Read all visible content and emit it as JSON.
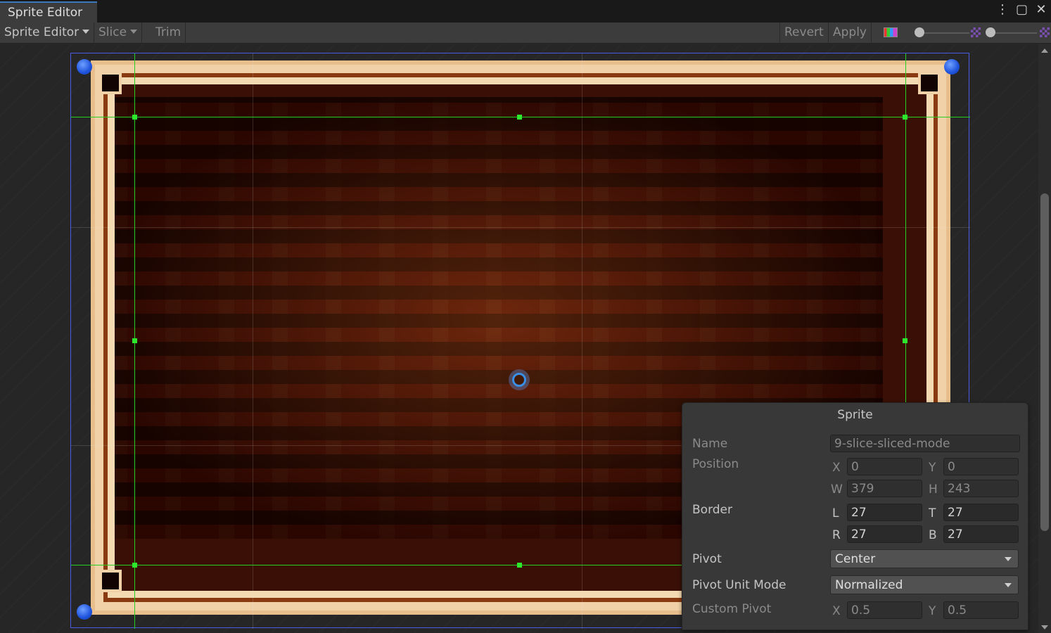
{
  "window": {
    "tab_title": "Sprite Editor"
  },
  "icons": {
    "kebab": "more-options-icon",
    "maximize": "maximize-icon",
    "close": "close-icon"
  },
  "toolbar": {
    "mode_label": "Sprite Editor",
    "slice_label": "Slice",
    "trim_label": "Trim",
    "revert_label": "Revert",
    "apply_label": "Apply"
  },
  "sprite_panel": {
    "title": "Sprite",
    "name_label": "Name",
    "name_value": "9-slice-sliced-mode",
    "position_label": "Position",
    "x_label": "X",
    "x_value": "0",
    "y_label": "Y",
    "y_value": "0",
    "w_label": "W",
    "w_value": "379",
    "h_label": "H",
    "h_value": "243",
    "border_label": "Border",
    "l_label": "L",
    "l_value": "27",
    "t_label": "T",
    "t_value": "27",
    "r_label": "R",
    "r_value": "27",
    "b_label": "B",
    "b_value": "27",
    "pivot_label": "Pivot",
    "pivot_value": "Center",
    "pivot_unit_mode_label": "Pivot Unit Mode",
    "pivot_unit_mode_value": "Normalized",
    "custom_pivot_label": "Custom Pivot",
    "cp_x_label": "X",
    "cp_x_value": "0.5",
    "cp_y_label": "Y",
    "cp_y_value": "0.5"
  },
  "colors": {
    "accent": "#3a79bb",
    "slice_line": "#23d023",
    "rect_outline": "#4a5de0",
    "handle": "#1d52dc"
  }
}
